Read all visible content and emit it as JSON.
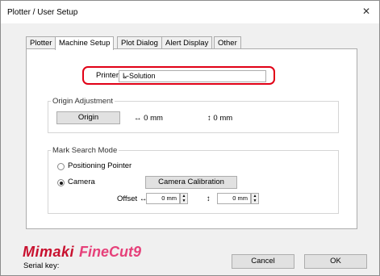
{
  "window": {
    "title": "Plotter / User Setup",
    "close_glyph": "✕"
  },
  "tabs": [
    {
      "label": "Plotter",
      "active": false
    },
    {
      "label": "Machine Setup",
      "active": true
    },
    {
      "label": "Plot Dialog",
      "active": false
    },
    {
      "label": "Alert Display",
      "active": false
    },
    {
      "label": "Other",
      "active": false
    }
  ],
  "printer": {
    "label": "Printer",
    "value": "L-Solution",
    "highlight_color": "#e10016"
  },
  "origin_adjustment": {
    "legend": "Origin Adjustment",
    "button_label": "Origin",
    "x_value": "0 mm",
    "y_value": "0 mm"
  },
  "mark_search": {
    "legend": "Mark Search Mode",
    "options": [
      {
        "label": "Positioning Pointer",
        "selected": false
      },
      {
        "label": "Camera",
        "selected": true
      }
    ],
    "calibration_button": "Camera Calibration",
    "offset_label": "Offset",
    "offset_x": "0 mm",
    "offset_y": "0 mm"
  },
  "footer": {
    "brand_name": "Mimaki",
    "product_name": "FineCut9",
    "serial_label": "Serial key:",
    "cancel_label": "Cancel",
    "ok_label": "OK"
  }
}
